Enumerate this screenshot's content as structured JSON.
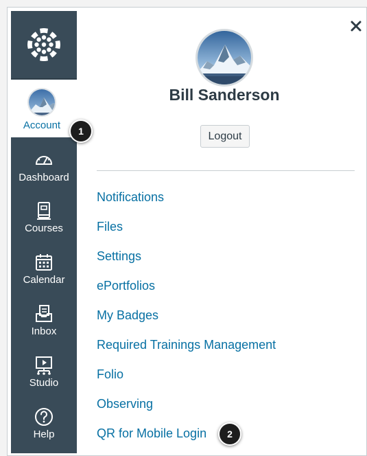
{
  "sidebar": {
    "logo_icon": "canvas-logo-icon",
    "account": {
      "label": "Account",
      "icon": "user-avatar-icon"
    },
    "items": [
      {
        "label": "Dashboard",
        "icon": "dashboard-icon"
      },
      {
        "label": "Courses",
        "icon": "courses-icon"
      },
      {
        "label": "Calendar",
        "icon": "calendar-icon"
      },
      {
        "label": "Inbox",
        "icon": "inbox-icon"
      },
      {
        "label": "Studio",
        "icon": "studio-icon"
      },
      {
        "label": "Help",
        "icon": "help-icon"
      }
    ]
  },
  "tray": {
    "close_icon": "close-icon",
    "user_name": "Bill Sanderson",
    "logout_label": "Logout",
    "links": [
      "Notifications",
      "Files",
      "Settings",
      "ePortfolios",
      "My Badges",
      "Required Trainings Management",
      "Folio",
      "Observing",
      "QR for Mobile Login"
    ]
  },
  "callouts": [
    "1",
    "2"
  ],
  "colors": {
    "sidebar_bg": "#394b58",
    "link": "#0770a3",
    "text_dark": "#2d3b45",
    "callout_bg": "#1d1d1d"
  }
}
